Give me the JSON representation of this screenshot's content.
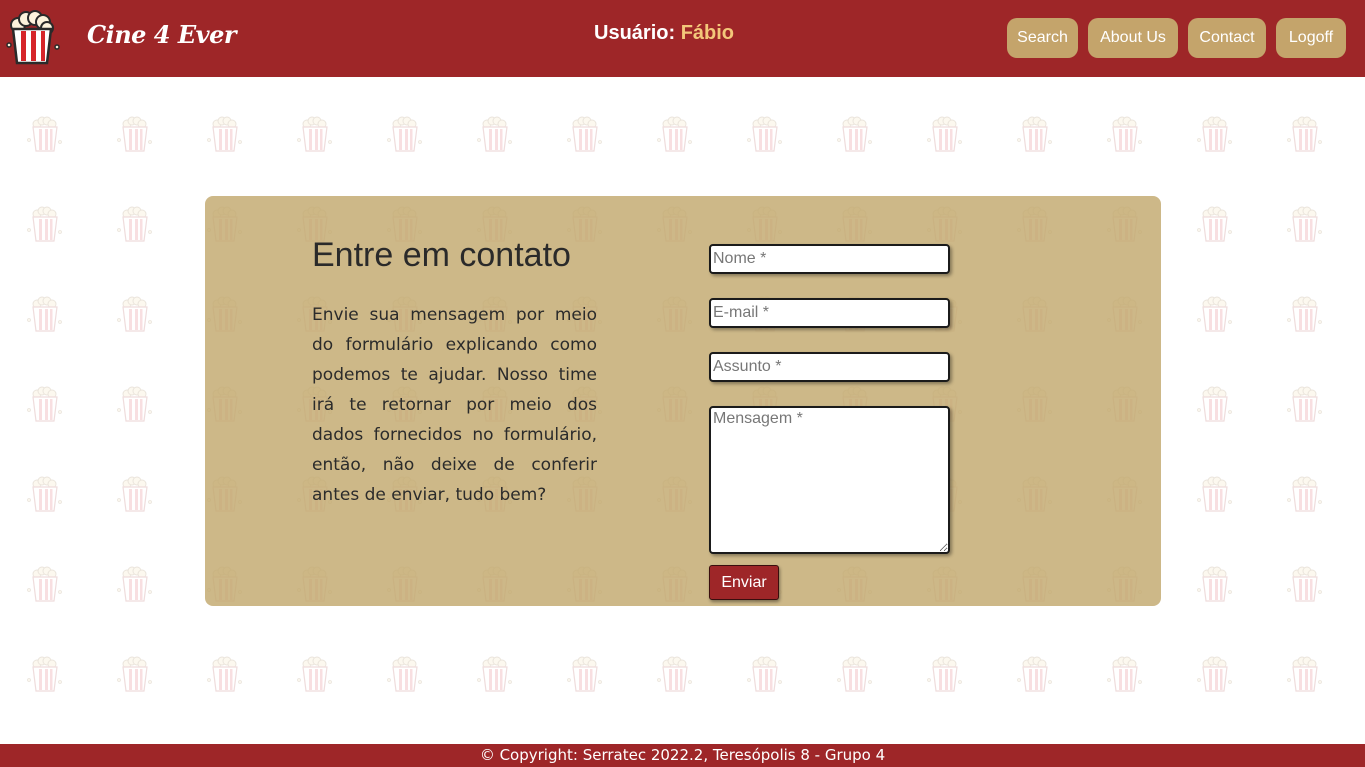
{
  "header": {
    "brand": "Cine 4 Ever",
    "user_label": "Usuário:",
    "user_name": "Fábio",
    "nav": [
      {
        "label": "Search"
      },
      {
        "label": "About Us"
      },
      {
        "label": "Contact"
      },
      {
        "label": "Logoff"
      }
    ]
  },
  "contact": {
    "title": "Entre em contato",
    "description": "Envie sua mensagem por meio do formulário explicando como podemos te ajudar. Nosso time irá te retornar por meio dos dados fornecidos no formulário, então, não deixe de conferir antes de enviar, tudo bem?",
    "name_placeholder": "Nome *",
    "email_placeholder": "E-mail *",
    "subject_placeholder": "Assunto *",
    "message_placeholder": "Mensagem *",
    "submit_label": "Enviar"
  },
  "footer": {
    "copyright": "© Copyright: Serratec 2022.2, Teresópolis 8 - Grupo 4"
  },
  "colors": {
    "primary": "#9e2628",
    "button": "#c4a46b",
    "card": "#cdb98b",
    "user_name": "#f3c77a"
  },
  "icons": {
    "logo": "popcorn-icon",
    "pattern": "popcorn-icon"
  }
}
